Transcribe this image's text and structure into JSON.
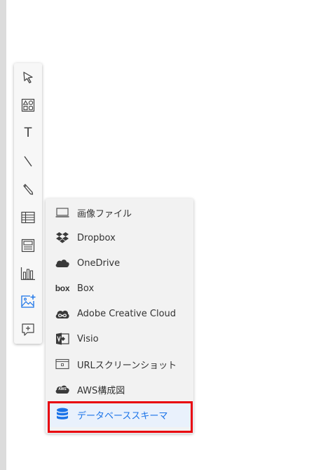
{
  "colors": {
    "accent": "#1a73e8",
    "highlight_border": "#e8000b",
    "menu_bg": "#f2f2f2",
    "toolbar_bg": "#f7f7f7"
  },
  "toolbar": {
    "tools": [
      {
        "icon": "cursor-arrow-icon",
        "selected": false
      },
      {
        "icon": "shapes-icon",
        "selected": false
      },
      {
        "icon": "text-icon",
        "label": "T",
        "selected": false
      },
      {
        "icon": "line-icon",
        "selected": false
      },
      {
        "icon": "pencil-icon",
        "selected": false
      },
      {
        "icon": "table-icon",
        "selected": false
      },
      {
        "icon": "card-icon",
        "selected": false
      },
      {
        "icon": "bar-chart-icon",
        "selected": false
      },
      {
        "icon": "insert-image-icon",
        "selected": true
      },
      {
        "icon": "add-comment-icon",
        "selected": false
      }
    ]
  },
  "image_menu": {
    "items": [
      {
        "label": "画像ファイル",
        "icon": "monitor-icon"
      },
      {
        "label": "Dropbox",
        "icon": "dropbox-icon"
      },
      {
        "label": "OneDrive",
        "icon": "onedrive-cloud-icon"
      },
      {
        "label": "Box",
        "icon": "box-logo-icon",
        "logo_text": "box"
      },
      {
        "label": "Adobe Creative Cloud",
        "icon": "adobe-creative-cloud-icon"
      },
      {
        "label": "Visio",
        "icon": "visio-icon"
      },
      {
        "label": "URLスクリーンショット",
        "icon": "browser-window-icon"
      },
      {
        "label": "AWS構成図",
        "icon": "aws-cloud-icon",
        "logo_text": "AWS"
      },
      {
        "label": "データベーススキーマ",
        "icon": "database-icon",
        "active": true
      }
    ]
  }
}
